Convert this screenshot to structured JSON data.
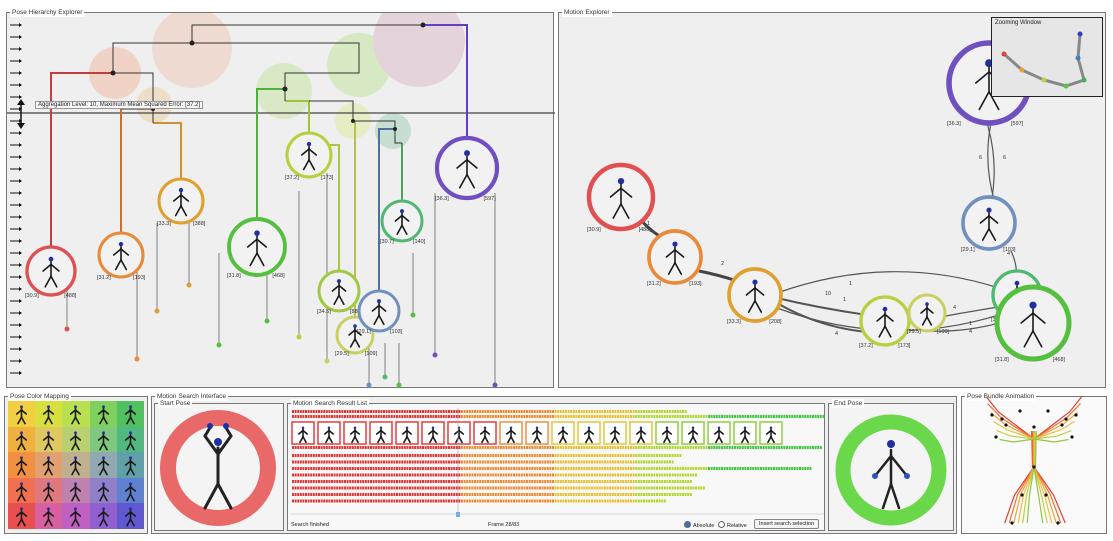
{
  "panels": {
    "hierarchy": "Pose Hierarchy Explorer",
    "motion": "Motion Explorer",
    "zoom": "Zooming Window",
    "color_mapping": "Pose Color Mapping",
    "search": "Motion Search Interface",
    "start_pose": "Start Pose",
    "result_list": "Motion Search Result List",
    "end_pose": "End Pose",
    "bundle": "Pose Bundle Animation"
  },
  "hierarchy": {
    "aggregation_label": "Aggregation Level: 10, Maximum Mean Squared Error: [37.2]",
    "nodes": [
      {
        "color": "#e05050",
        "left": "[30.9]",
        "right": "[488]"
      },
      {
        "color": "#e88a3a",
        "left": "[31.2]",
        "right": "[193]"
      },
      {
        "color": "#e0a030",
        "left": "[33.3]",
        "right": "[388]"
      },
      {
        "color": "#55c040",
        "left": "[31.8]",
        "right": "[468]"
      },
      {
        "color": "#b8d040",
        "left": "[37.2]",
        "right": "[173]"
      },
      {
        "color": "#a0c840",
        "left": "[34.5]",
        "right": "[88]"
      },
      {
        "color": "#c8d060",
        "left": "[29.5]",
        "right": "[109]"
      },
      {
        "color": "#7090c0",
        "left": "[29.1]",
        "right": "[103]"
      },
      {
        "color": "#50b870",
        "left": "[30.7]",
        "right": "[140]"
      },
      {
        "color": "#7050c0",
        "left": "[36.3]",
        "right": "[597]"
      }
    ]
  },
  "motion": {
    "nodes": [
      {
        "color": "#7050c0",
        "left": "[36.3]",
        "right": "[597]"
      },
      {
        "color": "#7090c0",
        "left": "[29.1]",
        "right": "[103]"
      },
      {
        "color": "#e05050",
        "left": "[30.9]",
        "right": "[488]"
      },
      {
        "color": "#e88a3a",
        "left": "[31.2]",
        "right": "[193]"
      },
      {
        "color": "#e0a030",
        "left": "[33.3]",
        "right": "[208]"
      },
      {
        "color": "#b8d040",
        "left": "[37.2]",
        "right": "[173]"
      },
      {
        "color": "#c8d060",
        "left": "[29.5]",
        "right": "[109]"
      },
      {
        "color": "#50b870",
        "left": "[30.7]",
        "right": "[140]"
      },
      {
        "color": "#55c040",
        "left": "[31.8]",
        "right": "[468]"
      }
    ],
    "edge_labels": [
      "6",
      "6",
      "4",
      "1",
      "1",
      "2",
      "10",
      "4",
      "4",
      "1",
      "4",
      "1"
    ]
  },
  "search": {
    "status": "Search finished",
    "frame": "Frame 28/83",
    "absolute_label": "Absolute",
    "relative_label": "Relative",
    "insert_button": "Insert search selection",
    "mode_selected": "Absolute"
  },
  "colors": {
    "panel_bg": "#efefef",
    "border": "#777777"
  }
}
